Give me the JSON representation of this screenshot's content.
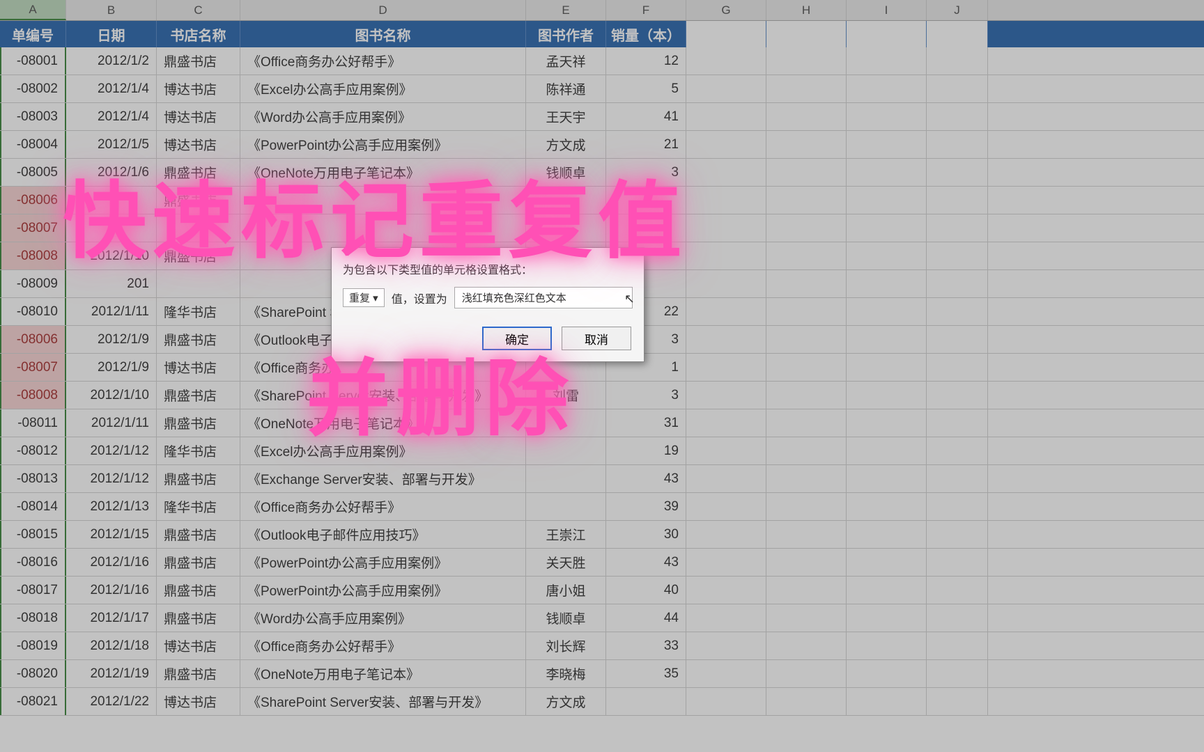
{
  "columns": [
    "A",
    "B",
    "C",
    "D",
    "E",
    "F",
    "G",
    "H",
    "I",
    "J"
  ],
  "selectedCol": "A",
  "headers": {
    "A": "单编号",
    "B": "日期",
    "C": "书店名称",
    "D": "图书名称",
    "E": "图书作者",
    "F": "销量（本）"
  },
  "rows": [
    {
      "a": "-08001",
      "dup": false,
      "b": "2012/1/2",
      "c": "鼎盛书店",
      "d": "《Office商务办公好帮手》",
      "e": "孟天祥",
      "f": "12"
    },
    {
      "a": "-08002",
      "dup": false,
      "b": "2012/1/4",
      "c": "博达书店",
      "d": "《Excel办公高手应用案例》",
      "e": "陈祥通",
      "f": "5"
    },
    {
      "a": "-08003",
      "dup": false,
      "b": "2012/1/4",
      "c": "博达书店",
      "d": "《Word办公高手应用案例》",
      "e": "王天宇",
      "f": "41"
    },
    {
      "a": "-08004",
      "dup": false,
      "b": "2012/1/5",
      "c": "博达书店",
      "d": "《PowerPoint办公高手应用案例》",
      "e": "方文成",
      "f": "21"
    },
    {
      "a": "-08005",
      "dup": false,
      "b": "2012/1/6",
      "c": "鼎盛书店",
      "d": "《OneNote万用电子笔记本》",
      "e": "钱顺卓",
      "f": "3"
    },
    {
      "a": "-08006",
      "dup": true,
      "b": "",
      "c": "鼎盛书店",
      "d": "",
      "e": "",
      "f": ""
    },
    {
      "a": "-08007",
      "dup": true,
      "b": "",
      "c": "",
      "d": "",
      "e": "",
      "f": ""
    },
    {
      "a": "-08008",
      "dup": true,
      "b": "2012/1/10",
      "c": "鼎盛书店",
      "d": "",
      "e": "",
      "f": ""
    },
    {
      "a": "-08009",
      "dup": false,
      "b": "201",
      "c": "",
      "d": "",
      "e": "",
      "f": ""
    },
    {
      "a": "-08010",
      "dup": false,
      "b": "2012/1/11",
      "c": "隆华书店",
      "d": "《SharePoint S",
      "e": "",
      "f": "22"
    },
    {
      "a": "-08006",
      "dup": true,
      "b": "2012/1/9",
      "c": "鼎盛书店",
      "d": "《Outlook电子",
      "e": "",
      "f": "3"
    },
    {
      "a": "-08007",
      "dup": true,
      "b": "2012/1/9",
      "c": "博达书店",
      "d": "《Office商务办",
      "e": "",
      "f": "1"
    },
    {
      "a": "-08008",
      "dup": true,
      "b": "2012/1/10",
      "c": "鼎盛书店",
      "d": "《SharePoint Server安装、部署与开发》",
      "e": "刘雷",
      "f": "3"
    },
    {
      "a": "-08011",
      "dup": false,
      "b": "2012/1/11",
      "c": "鼎盛书店",
      "d": "《OneNote万用电子笔记本》",
      "e": "",
      "f": "31"
    },
    {
      "a": "-08012",
      "dup": false,
      "b": "2012/1/12",
      "c": "隆华书店",
      "d": "《Excel办公高手应用案例》",
      "e": "",
      "f": "19"
    },
    {
      "a": "-08013",
      "dup": false,
      "b": "2012/1/12",
      "c": "鼎盛书店",
      "d": "《Exchange Server安装、部署与开发》",
      "e": "",
      "f": "43"
    },
    {
      "a": "-08014",
      "dup": false,
      "b": "2012/1/13",
      "c": "隆华书店",
      "d": "《Office商务办公好帮手》",
      "e": "",
      "f": "39"
    },
    {
      "a": "-08015",
      "dup": false,
      "b": "2012/1/15",
      "c": "鼎盛书店",
      "d": "《Outlook电子邮件应用技巧》",
      "e": "王崇江",
      "f": "30"
    },
    {
      "a": "-08016",
      "dup": false,
      "b": "2012/1/16",
      "c": "鼎盛书店",
      "d": "《PowerPoint办公高手应用案例》",
      "e": "关天胜",
      "f": "43"
    },
    {
      "a": "-08017",
      "dup": false,
      "b": "2012/1/16",
      "c": "鼎盛书店",
      "d": "《PowerPoint办公高手应用案例》",
      "e": "唐小姐",
      "f": "40"
    },
    {
      "a": "-08018",
      "dup": false,
      "b": "2012/1/17",
      "c": "鼎盛书店",
      "d": "《Word办公高手应用案例》",
      "e": "钱顺卓",
      "f": "44"
    },
    {
      "a": "-08019",
      "dup": false,
      "b": "2012/1/18",
      "c": "博达书店",
      "d": "《Office商务办公好帮手》",
      "e": "刘长辉",
      "f": "33"
    },
    {
      "a": "-08020",
      "dup": false,
      "b": "2012/1/19",
      "c": "鼎盛书店",
      "d": "《OneNote万用电子笔记本》",
      "e": "李晓梅",
      "f": "35"
    },
    {
      "a": "-08021",
      "dup": false,
      "b": "2012/1/22",
      "c": "博达书店",
      "d": "《SharePoint Server安装、部署与开发》",
      "e": "方文成",
      "f": ""
    }
  ],
  "dialog": {
    "title": "为包含以下类型值的单元格设置格式：",
    "rule_label": "重复",
    "mid_text": "值，设置为",
    "format_value": "浅红填充色深红色文本",
    "ok": "确定",
    "cancel": "取消"
  },
  "overlay_text": {
    "line1": "快速标记重复值",
    "line2": "并删除"
  }
}
